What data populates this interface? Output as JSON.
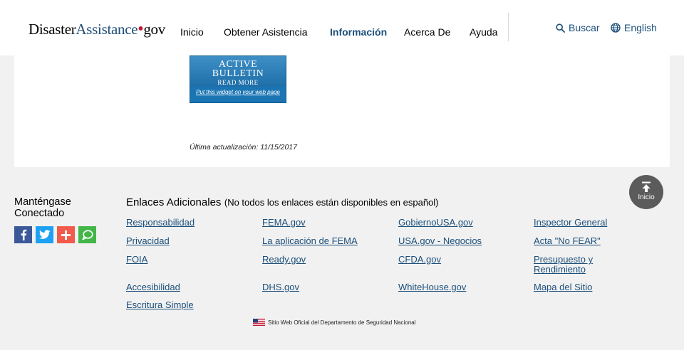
{
  "header": {
    "logo": {
      "part1": "Disaster",
      "part2": "Assistance",
      "dot": "•",
      "part3": "gov"
    },
    "nav": [
      "Inicio",
      "Obtener Asistencia",
      "Información",
      "Acerca De",
      "Ayuda"
    ],
    "search_label": "Buscar",
    "language_label": "English"
  },
  "widget": {
    "line1": "ACTIVE",
    "line2": "BULLETIN",
    "read_more": "READ MORE",
    "link": "Put this widget on your web page"
  },
  "content": {
    "last_updated": "Última actualización: 11/15/2017"
  },
  "back_to_top": {
    "label": "Inicio"
  },
  "footer": {
    "connect_title": "Manténgase Conectado",
    "social": [
      "facebook-icon",
      "twitter-icon",
      "share-plus-icon",
      "chat-icon"
    ],
    "links_title": "Enlaces Adicionales",
    "links_note": "(No todos los enlaces están disponibles en español)",
    "columns": [
      [
        "Responsabilidad",
        "Privacidad",
        "FOIA",
        "Accesibilidad",
        "Escritura Simple"
      ],
      [
        "FEMA.gov",
        "La aplicación de FEMA",
        "Ready.gov",
        "DHS.gov"
      ],
      [
        "GobiernoUSA.gov",
        "USA.gov - Negocios",
        "CFDA.gov",
        "WhiteHouse.gov"
      ],
      [
        "Inspector General",
        "Acta \"No FEAR\"",
        "Presupuesto y Rendimiento",
        "Mapa del Sitio"
      ]
    ],
    "official_site": "Sitio Web Oficial del Departamento de Seguridad Nacional"
  },
  "colors": {
    "link": "#1b4f7a",
    "logo_dot": "#c41230",
    "facebook": "#3b5998",
    "twitter": "#1da1f2",
    "share": "#f25a4b",
    "chat": "#43b649"
  }
}
